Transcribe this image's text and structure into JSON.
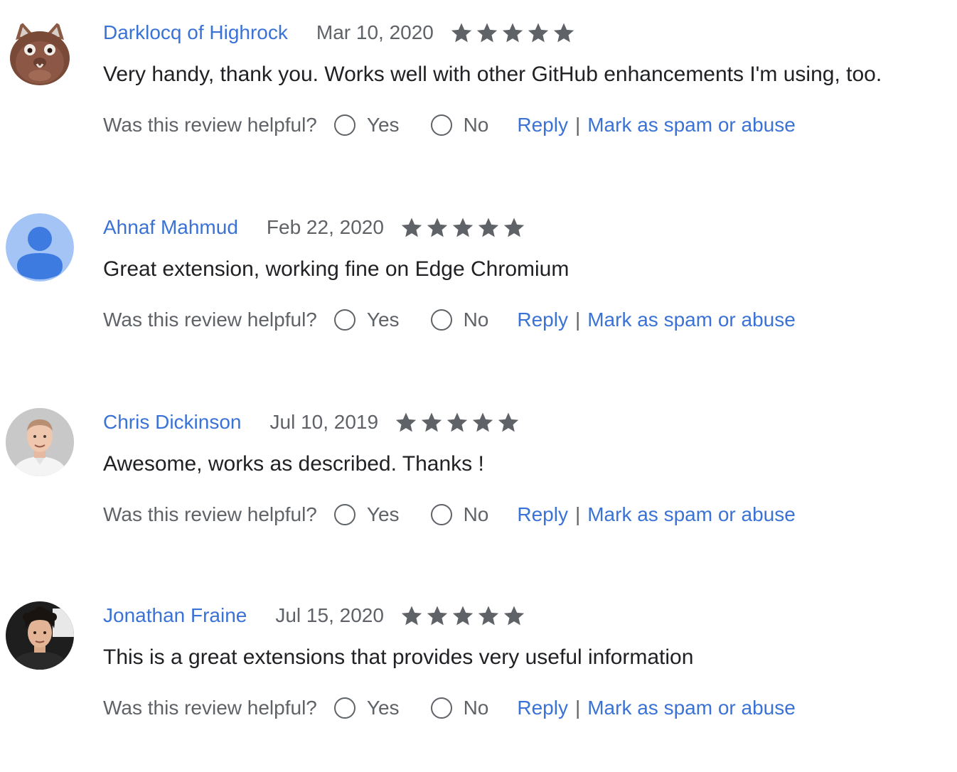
{
  "reviews": [
    {
      "author": "Darklocq of Highrock",
      "date": "Mar 10, 2020",
      "rating": 5,
      "text": "Very handy, thank you.  Works well with other GitHub enhancements I'm using, too.",
      "helpful_question": "Was this review helpful?",
      "yes_label": "Yes",
      "no_label": "No",
      "reply_label": "Reply",
      "separator": "|",
      "spam_label": "Mark as spam or abuse"
    },
    {
      "author": "Ahnaf Mahmud",
      "date": "Feb 22, 2020",
      "rating": 5,
      "text": "Great extension, working fine on Edge Chromium",
      "helpful_question": "Was this review helpful?",
      "yes_label": "Yes",
      "no_label": "No",
      "reply_label": "Reply",
      "separator": "|",
      "spam_label": "Mark as spam or abuse"
    },
    {
      "author": "Chris Dickinson",
      "date": "Jul 10, 2019",
      "rating": 5,
      "text": "Awesome, works as described. Thanks !",
      "helpful_question": "Was this review helpful?",
      "yes_label": "Yes",
      "no_label": "No",
      "reply_label": "Reply",
      "separator": "|",
      "spam_label": "Mark as spam or abuse"
    },
    {
      "author": "Jonathan Fraine",
      "date": "Jul 15, 2020",
      "rating": 5,
      "text": "This is a great extensions that provides very useful information",
      "helpful_question": "Was this review helpful?",
      "yes_label": "Yes",
      "no_label": "No",
      "reply_label": "Reply",
      "separator": "|",
      "spam_label": "Mark as spam or abuse"
    }
  ],
  "colors": {
    "link": "#3a72d6",
    "secondary_text": "#5f6368",
    "primary_text": "#202124",
    "star": "#5f6368"
  }
}
